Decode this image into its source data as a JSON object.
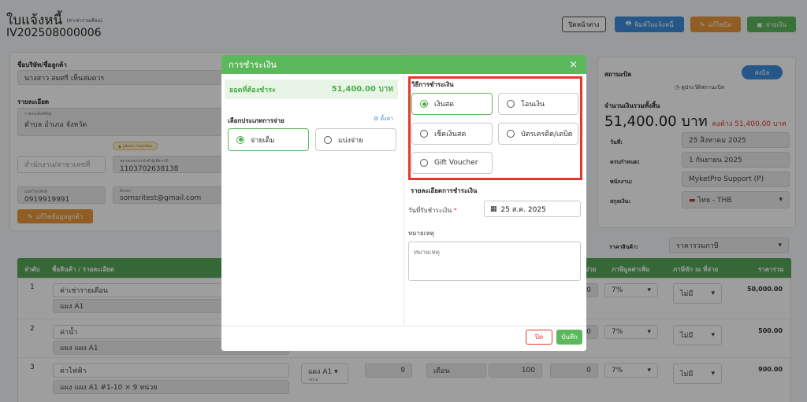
{
  "page": {
    "title": "ใบแจ้งหนี้",
    "title_note": "(ค่าเช่ารายเดือน)",
    "doc_no": "IV202508000006",
    "buttons": {
      "close_window": "ปิดหน้าต่าง",
      "print": "พิมพ์ใบแจ้งหนี้",
      "edit": "แก้ไขบิล",
      "pay": "จ่ายเงิน"
    }
  },
  "customer": {
    "name_label": "ชื่อบริษัท/ชื่อลูกค้า",
    "name": "นางสาว สมศรี เห็นสมควร",
    "detail_label": "รายละเอียด",
    "address_label": "รายละเอียดที่อยู่",
    "address": "ตำบล อำเภอ จังหวัด",
    "warning_badge": "รูปแบบ ไม่ถูกต้อง",
    "branch_placeholder": "สำนักงาน/สาขาเลขที่",
    "tax_label": "หมายเลขประจำตัวผู้เสียภาษี",
    "tax_id": "1103702638138",
    "phone_label": "เบอร์โทรศัพท์",
    "phone": "0919919991",
    "email_label": "Email",
    "email": "somsritest@gmail.com",
    "edit_button": "แก้ไขข้อมูลลูกค้า"
  },
  "status": {
    "label": "สถานะบิล",
    "badge": "ส่งบิล",
    "link": "ดูประวัติสถานะบิล",
    "total_label": "จำนวนเงินรวมทั้งสิ้น",
    "total": "51,400.00 บาท",
    "outstanding": "คงค้าง 51,400.00 บาท",
    "date_label": "วันที่:",
    "date": "25 สิงหาคม 2025",
    "due_label": "ครบกำหนด:",
    "due": "1 กันยายน 2025",
    "staff_label": "พนักงาน:",
    "staff": "MyketPro Support (P)",
    "currency_label": "สกุลเงิน:",
    "currency": "ไทย - THB",
    "price_type_label": "ราคาสินค้า:",
    "price_type": "ราคารวมภาษี"
  },
  "table": {
    "headers": {
      "no": "ลำดับ",
      "item": "ชื่อสินค้า / รายละเอียด",
      "unit_tail": "ม่วย",
      "vat": "ภาษีมูลค่าเพิ่ม",
      "wht": "ภาษีหัก ณ ที่จ่าย",
      "total": "ราคารวม"
    },
    "rows": [
      {
        "no": "1",
        "name": "ค่าเช่ารายเดือน",
        "detail": "แผง A1",
        "discount": "0",
        "vat": "7%",
        "wht": "ไม่มี",
        "total": "50,000.00"
      },
      {
        "no": "2",
        "name": "ค่าน้ำ",
        "detail": "แผง แผง A1",
        "discount": "0",
        "vat": "7%",
        "wht": "ไม่มี",
        "total": "500.00"
      },
      {
        "no": "3",
        "name": "ค่าไฟฟ้า",
        "detail": "แผง แผง A1 #1-10 × 9 หน่วย",
        "unit_sel": "แผง A1",
        "unit_sub": "-ตร.ม",
        "qty": "9",
        "unit": "เดือน",
        "price": "100",
        "discount": "0",
        "vat": "7%",
        "wht": "ไม่มี",
        "total": "900.00"
      }
    ]
  },
  "modal": {
    "title": "การชำระเงิน",
    "due_label": "ยอดที่ต้องชำระ",
    "due_amount": "51,400.00 บาท",
    "type_label": "เลือกประเภทการจ่าย",
    "settings": "ตั้งค่า",
    "type_options": [
      "จ่ายเต็ม",
      "แบ่งจ่าย"
    ],
    "method_label": "วิธีการชำระเงิน",
    "methods": [
      "เงินสด",
      "โอนเงิน",
      "เช็คเงินสด",
      "บัตรเครดิต/เดบิต",
      "Gift Voucher"
    ],
    "detail_label": "รายละเอียดการชำระเงิน",
    "date_label": "วันที่รับชำระเงิน",
    "date_value": "25 ส.ค. 2025",
    "note_label": "หมายเหตุ",
    "note_placeholder": "หมายเหตุ",
    "close_button": "ปิด",
    "save_button": "บันทึก",
    "highlight_color": "#e03a2c",
    "accent": "#5cb85c"
  }
}
